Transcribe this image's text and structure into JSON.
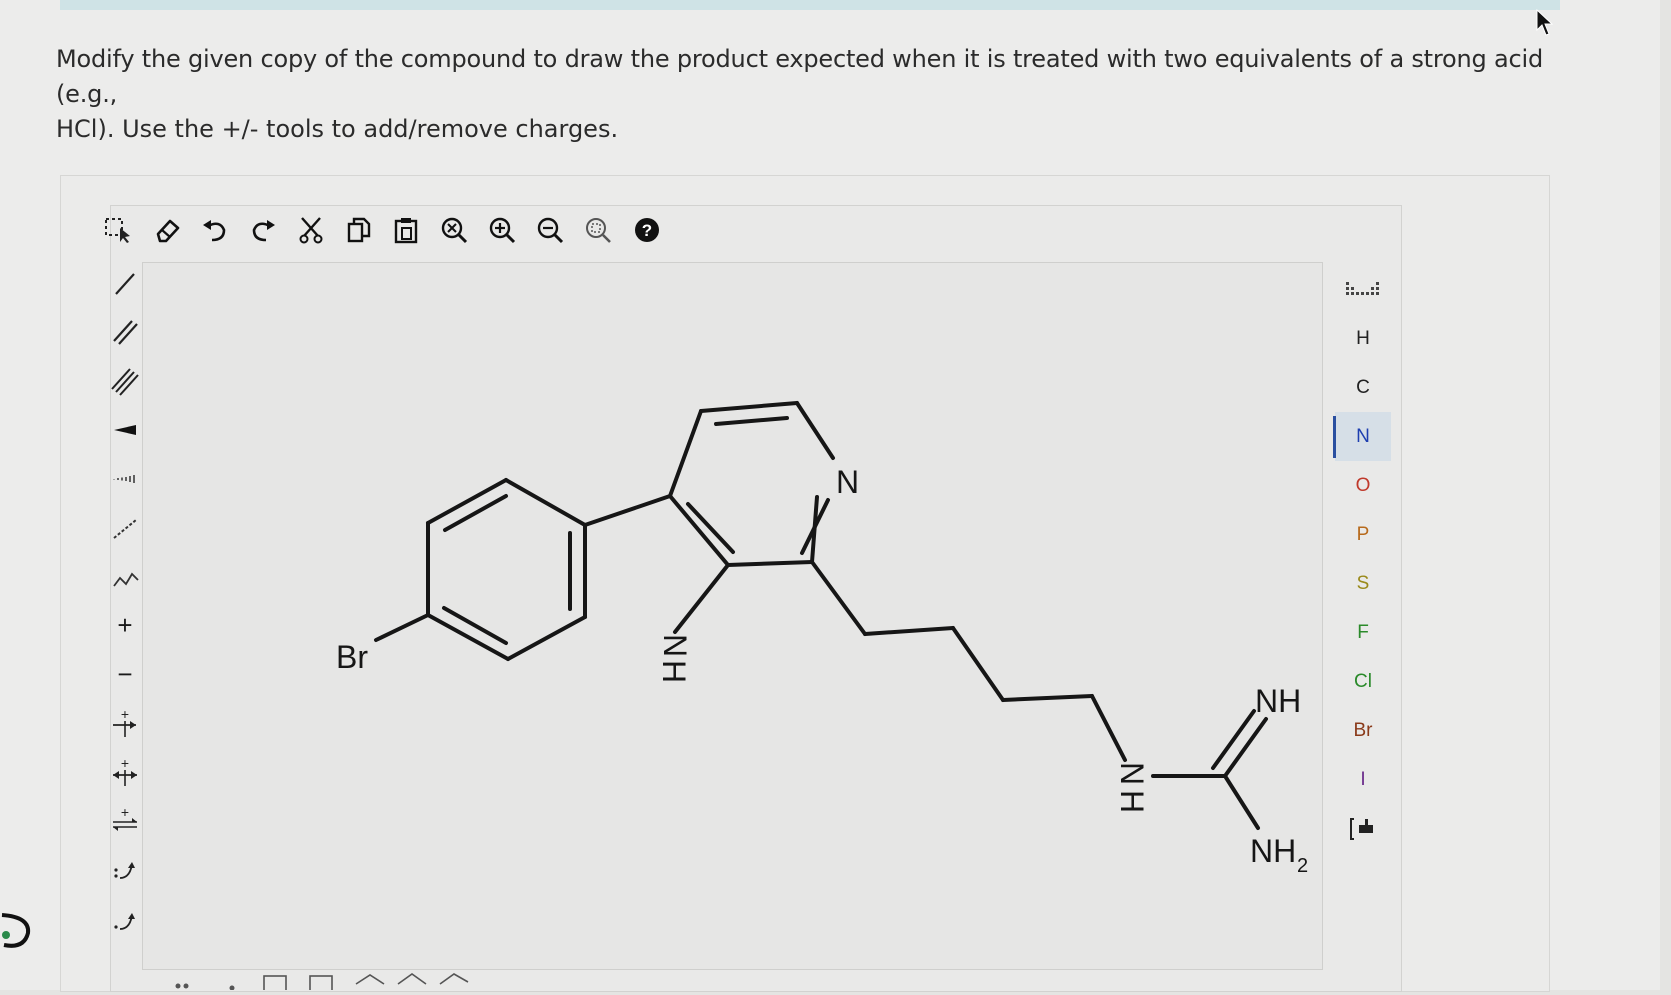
{
  "question": {
    "line1": "Modify the given copy of the compound to draw the product expected when it is treated with two equivalents of a strong acid (e.g.,",
    "line2": "HCl). Use the +/- tools to add/remove charges."
  },
  "toolbar_top": [
    {
      "name": "select-icon"
    },
    {
      "name": "eraser-icon"
    },
    {
      "name": "undo-icon"
    },
    {
      "name": "redo-icon"
    },
    {
      "name": "cut-icon"
    },
    {
      "name": "copy-icon"
    },
    {
      "name": "paste-icon"
    },
    {
      "name": "zoom-reset-icon"
    },
    {
      "name": "zoom-in-icon"
    },
    {
      "name": "zoom-out-icon"
    },
    {
      "name": "zoom-fit-icon"
    },
    {
      "name": "help-icon"
    }
  ],
  "left_tools": {
    "charge_plus": "+",
    "charge_minus": "−"
  },
  "right_tools": {
    "elements": [
      "H",
      "C",
      "N",
      "O",
      "P",
      "S",
      "F",
      "Cl",
      "Br",
      "I"
    ],
    "selected": "N"
  },
  "molecule": {
    "labels": {
      "br": "Br",
      "pyridine_n": "N",
      "indole_n": "N",
      "indole_h": "H",
      "amine_n": "N",
      "amine_h": "H",
      "imine": "NH",
      "amino": "NH",
      "amino_sub": "2"
    }
  },
  "colors": {
    "bond": "#161616",
    "nitrogen": "#1e3fb0",
    "selected_accent": "#2a4fa0"
  }
}
